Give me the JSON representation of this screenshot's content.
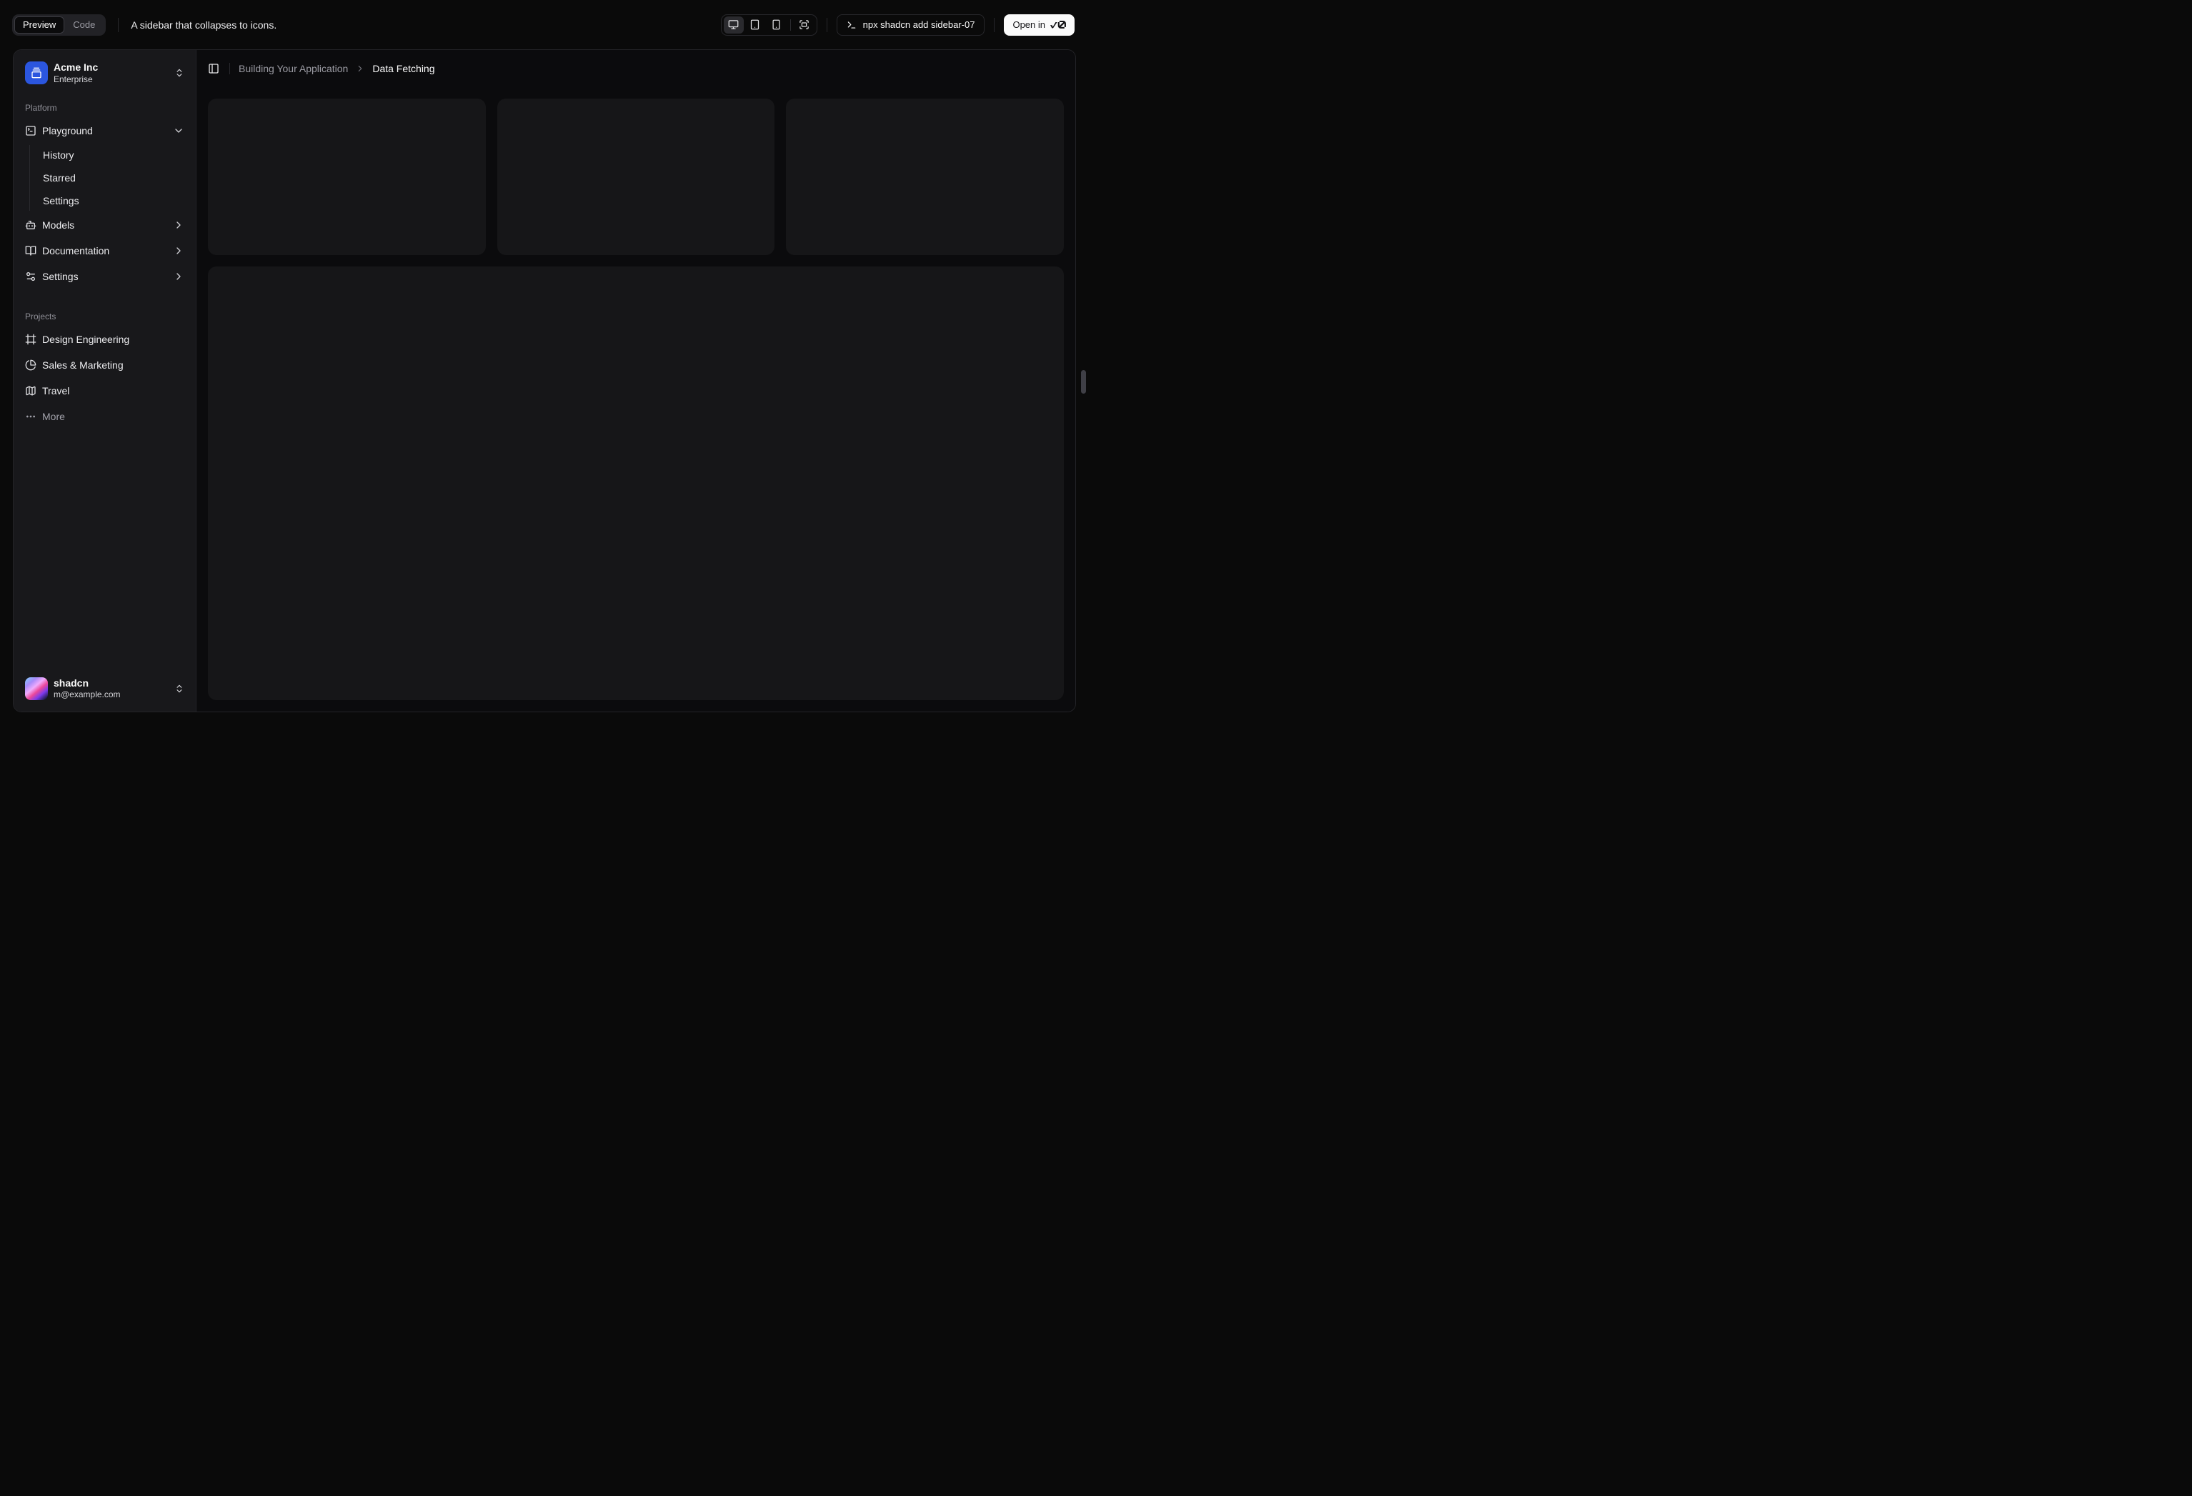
{
  "topbar": {
    "view_tabs": [
      {
        "label": "Preview",
        "active": true
      },
      {
        "label": "Code",
        "active": false
      }
    ],
    "description": "A sidebar that collapses to icons.",
    "device_toggles": [
      {
        "name": "desktop",
        "icon": "monitor",
        "active": true
      },
      {
        "name": "tablet",
        "icon": "tablet",
        "active": false
      },
      {
        "name": "mobile",
        "icon": "smartphone",
        "active": false
      }
    ],
    "fullscreen": {
      "icon": "fullscreen"
    },
    "command": {
      "icon": "terminal",
      "text": "npx shadcn add sidebar-07"
    },
    "open_in": {
      "label": "Open in",
      "logo": "v0-logo"
    }
  },
  "preview": {
    "sidebar": {
      "team": {
        "name": "Acme Inc",
        "plan": "Enterprise",
        "logo_icon": "gallery-vertical-end",
        "trailing_icon": "chevrons-up-down"
      },
      "groups": [
        {
          "label": "Platform",
          "items": [
            {
              "label": "Playground",
              "icon": "square-terminal",
              "trailing": "chevron-down",
              "children": [
                "History",
                "Starred",
                "Settings"
              ]
            },
            {
              "label": "Models",
              "icon": "bot",
              "trailing": "chevron-right"
            },
            {
              "label": "Documentation",
              "icon": "book-open",
              "trailing": "chevron-right"
            },
            {
              "label": "Settings",
              "icon": "settings-2",
              "trailing": "chevron-right"
            }
          ]
        },
        {
          "label": "Projects",
          "items": [
            {
              "label": "Design Engineering",
              "icon": "frame"
            },
            {
              "label": "Sales & Marketing",
              "icon": "chart-pie"
            },
            {
              "label": "Travel",
              "icon": "map"
            },
            {
              "label": "More",
              "icon": "ellipsis",
              "muted": true
            }
          ]
        }
      ],
      "user": {
        "name": "shadcn",
        "email": "m@example.com",
        "avatar": "user-avatar-image",
        "trailing_icon": "chevrons-up-down"
      }
    },
    "header": {
      "toggle_icon": "panel-left",
      "breadcrumb": {
        "parent": "Building Your Application",
        "separator_icon": "chevron-right",
        "current": "Data Fetching"
      }
    },
    "content": {
      "placeholder_cards": 3,
      "large_placeholder": 1
    }
  },
  "colors": {
    "accent_blue": "#2b56df",
    "page_bg": "#0a0a0a",
    "sidebar_bg": "#18181b",
    "card_bg": "#161618",
    "primary_text": "#fafafa",
    "muted_text": "#a1a1aa",
    "open_button_bg": "#fafafa"
  }
}
